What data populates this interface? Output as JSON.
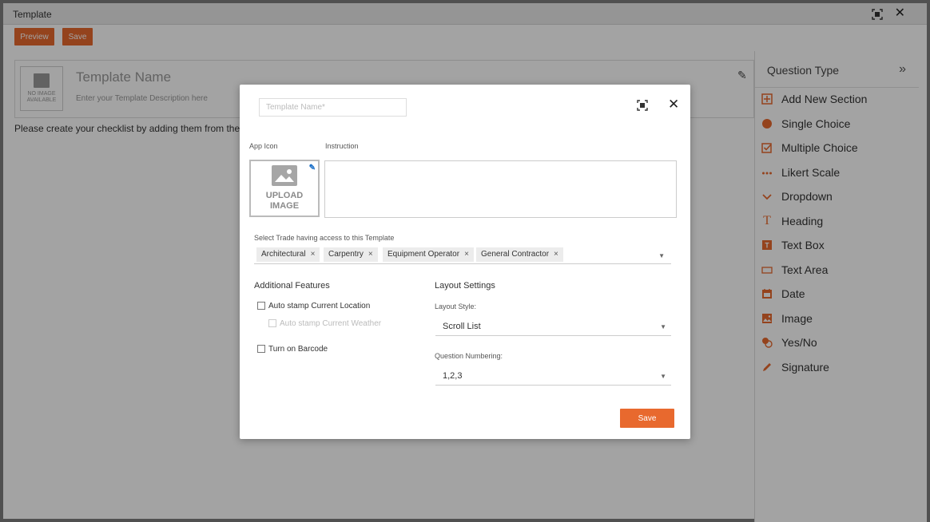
{
  "window": {
    "title": "Template"
  },
  "toolbar": {
    "preview_label": "Preview",
    "save_label": "Save"
  },
  "template": {
    "no_image_text": "NO IMAGE AVAILABLE",
    "name": "Template Name",
    "description_placeholder": "Enter your Template Description here"
  },
  "helper_text": "Please create your checklist by adding them from the q",
  "question_panel": {
    "title": "Question Type",
    "items": [
      {
        "label": "Add New Section",
        "icon": "plus-box-icon"
      },
      {
        "label": "Single Choice",
        "icon": "radio-icon"
      },
      {
        "label": "Multiple Choice",
        "icon": "checkbox-icon"
      },
      {
        "label": "Likert Scale",
        "icon": "dots-icon"
      },
      {
        "label": "Dropdown",
        "icon": "chevron-down-icon"
      },
      {
        "label": "Heading",
        "icon": "heading-icon"
      },
      {
        "label": "Text Box",
        "icon": "textbox-icon"
      },
      {
        "label": "Text Area",
        "icon": "textarea-icon"
      },
      {
        "label": "Date",
        "icon": "calendar-icon"
      },
      {
        "label": "Image",
        "icon": "image-icon"
      },
      {
        "label": "Yes/No",
        "icon": "yes-no-icon"
      },
      {
        "label": "Signature",
        "icon": "pen-icon"
      }
    ],
    "accent_color": "#e8692e"
  },
  "modal": {
    "name_placeholder": "Template Name*",
    "app_icon_label": "App Icon",
    "instruction_label": "Instruction",
    "upload_text": "UPLOAD IMAGE",
    "trade_label": "Select Trade having access to this Template",
    "trades": [
      "Architectural",
      "Carpentry",
      "Equipment Operator",
      "General Contractor"
    ],
    "additional_features_title": "Additional Features",
    "auto_stamp_location": "Auto stamp Current Location",
    "auto_stamp_weather": "Auto stamp Current Weather",
    "barcode": "Turn on Barcode",
    "layout_settings_title": "Layout Settings",
    "layout_style_label": "Layout Style:",
    "layout_style_value": "Scroll List",
    "numbering_label": "Question Numbering:",
    "numbering_value": "1,2,3",
    "save_label": "Save"
  }
}
